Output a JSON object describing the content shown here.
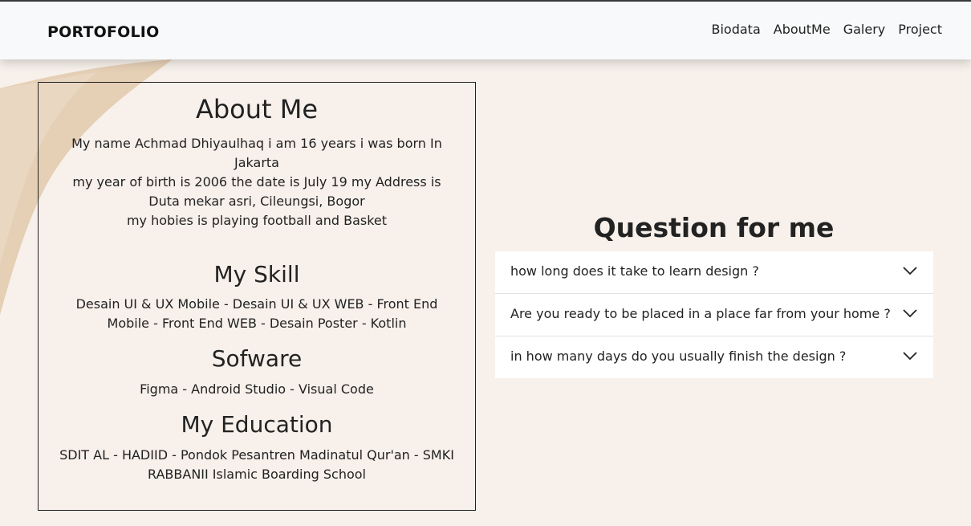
{
  "navbar": {
    "brand": "PORTOFOLIO",
    "links": [
      "Biodata",
      "AboutMe",
      "Galery",
      "Project"
    ]
  },
  "about": {
    "title": "About Me",
    "lines": [
      "My name Achmad Dhiyaulhaq i am 16 years i was born In Jakarta",
      "my year of birth is 2006 the date is July 19 my Address is Duta mekar asri, Cileungsi, Bogor",
      "my hobies is playing football and Basket"
    ],
    "skill": {
      "title": "My Skill",
      "text": "Desain UI & UX Mobile - Desain UI & UX WEB - Front End Mobile - Front End WEB - Desain Poster - Kotlin"
    },
    "software": {
      "title": "Sofware",
      "text": "Figma - Android Studio - Visual Code"
    },
    "education": {
      "title": "My Education",
      "text": "SDIT AL - HADIID - Pondok Pesantren Madinatul Qur'an - SMKI RABBANII Islamic Boarding School"
    }
  },
  "faq": {
    "title": "Question for me",
    "items": [
      "how long does it take to learn design ?",
      "Are you ready to be placed in a place far from your home ?",
      "in how many days do you usually finish the design ?"
    ]
  },
  "icons": {
    "accordion": "chevron-down-icon"
  },
  "colors": {
    "background": "#f7f0eb",
    "navbar": "#f8f9fa",
    "decor": "#e2c9ab"
  }
}
